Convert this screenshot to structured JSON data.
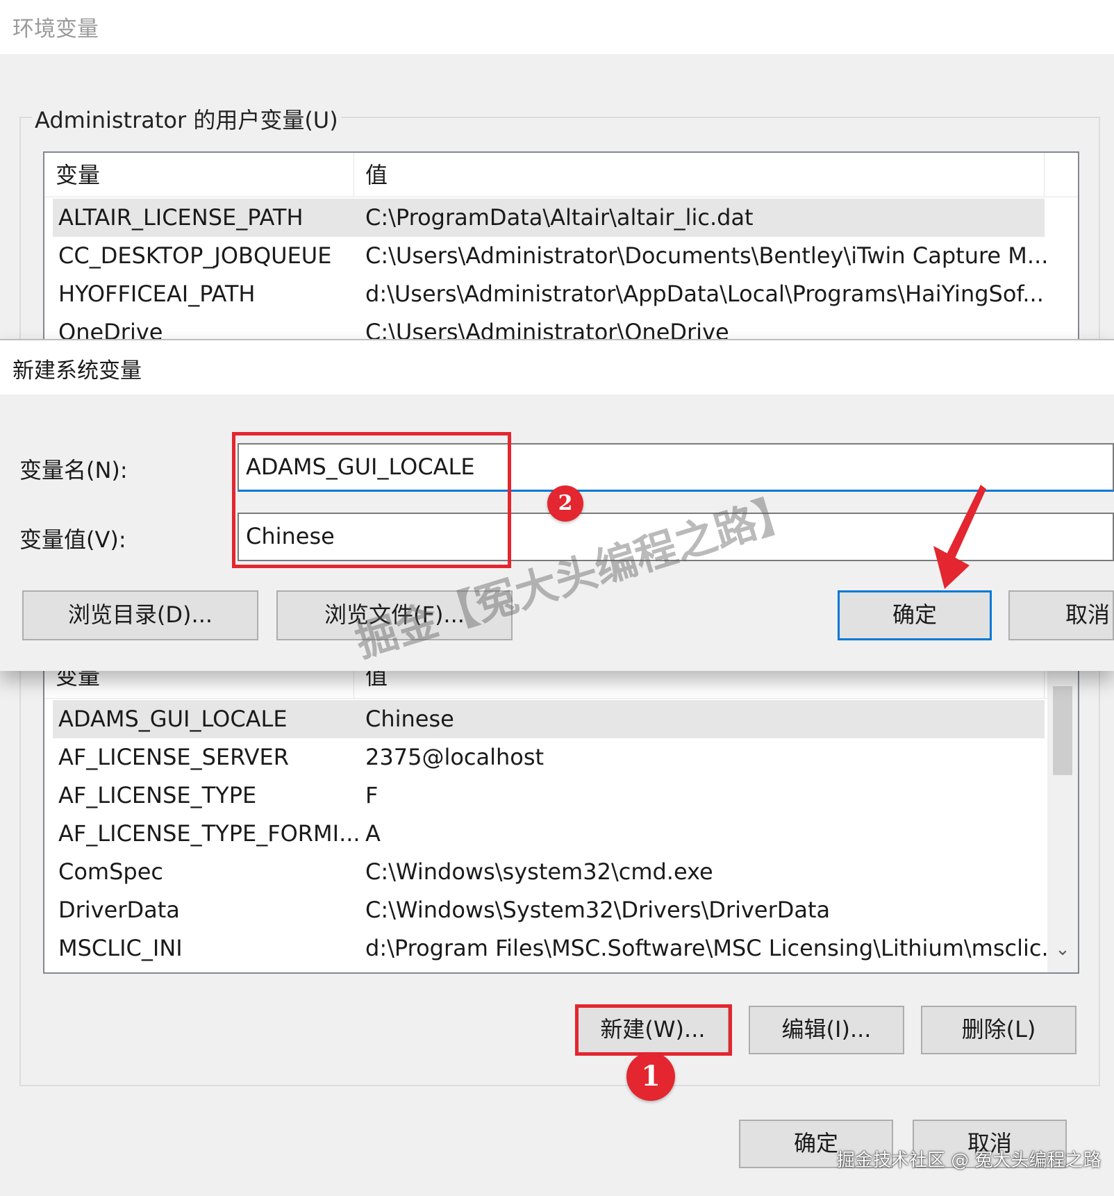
{
  "window": {
    "title": "环境变量"
  },
  "user_vars": {
    "group_label": "Administrator 的用户变量(U)",
    "columns": [
      "变量",
      "值"
    ],
    "rows": [
      {
        "name": "ALTAIR_LICENSE_PATH",
        "value": "C:\\ProgramData\\Altair\\altair_lic.dat"
      },
      {
        "name": "CC_DESKTOP_JOBQUEUE",
        "value": "C:\\Users\\Administrator\\Documents\\Bentley\\iTwin Capture M..."
      },
      {
        "name": "HYOFFICEAI_PATH",
        "value": "d:\\Users\\Administrator\\AppData\\Local\\Programs\\HaiYingSof..."
      },
      {
        "name": "OneDrive",
        "value": "C:\\Users\\Administrator\\OneDrive"
      }
    ]
  },
  "new_var_dialog": {
    "title": "新建系统变量",
    "name_label": "变量名(N):",
    "name_value": "ADAMS_GUI_LOCALE",
    "value_label": "变量值(V):",
    "value_value": "Chinese",
    "browse_dir_label": "浏览目录(D)...",
    "browse_file_label": "浏览文件(F)...",
    "ok_label": "确定",
    "cancel_label": "取消"
  },
  "system_vars": {
    "columns": [
      "变量",
      "值"
    ],
    "rows": [
      {
        "name": "ADAMS_GUI_LOCALE",
        "value": "Chinese"
      },
      {
        "name": "AF_LICENSE_SERVER",
        "value": "2375@localhost"
      },
      {
        "name": "AF_LICENSE_TYPE",
        "value": "F"
      },
      {
        "name": "AF_LICENSE_TYPE_FORMI...",
        "value": "A"
      },
      {
        "name": "ComSpec",
        "value": "C:\\Windows\\system32\\cmd.exe"
      },
      {
        "name": "DriverData",
        "value": "C:\\Windows\\System32\\Drivers\\DriverData"
      },
      {
        "name": "MSCLIC_INI",
        "value": "d:\\Program Files\\MSC.Software\\MSC Licensing\\Lithium\\msclic..."
      }
    ],
    "new_label": "新建(W)...",
    "edit_label": "编辑(I)...",
    "delete_label": "删除(L)"
  },
  "main_buttons": {
    "ok_label": "确定",
    "cancel_label": "取消"
  },
  "annotations": {
    "step1": "1",
    "step2": "2",
    "accent_color": "#e3262f"
  },
  "watermarks": {
    "center": "掘金【冤大头编程之路】",
    "footer": "掘金技术社区 @ 冤大头编程之路"
  },
  "icons": {
    "scroll_up": "chevron-up-icon",
    "scroll_down": "chevron-down-icon",
    "arrow": "red-arrow-icon"
  }
}
